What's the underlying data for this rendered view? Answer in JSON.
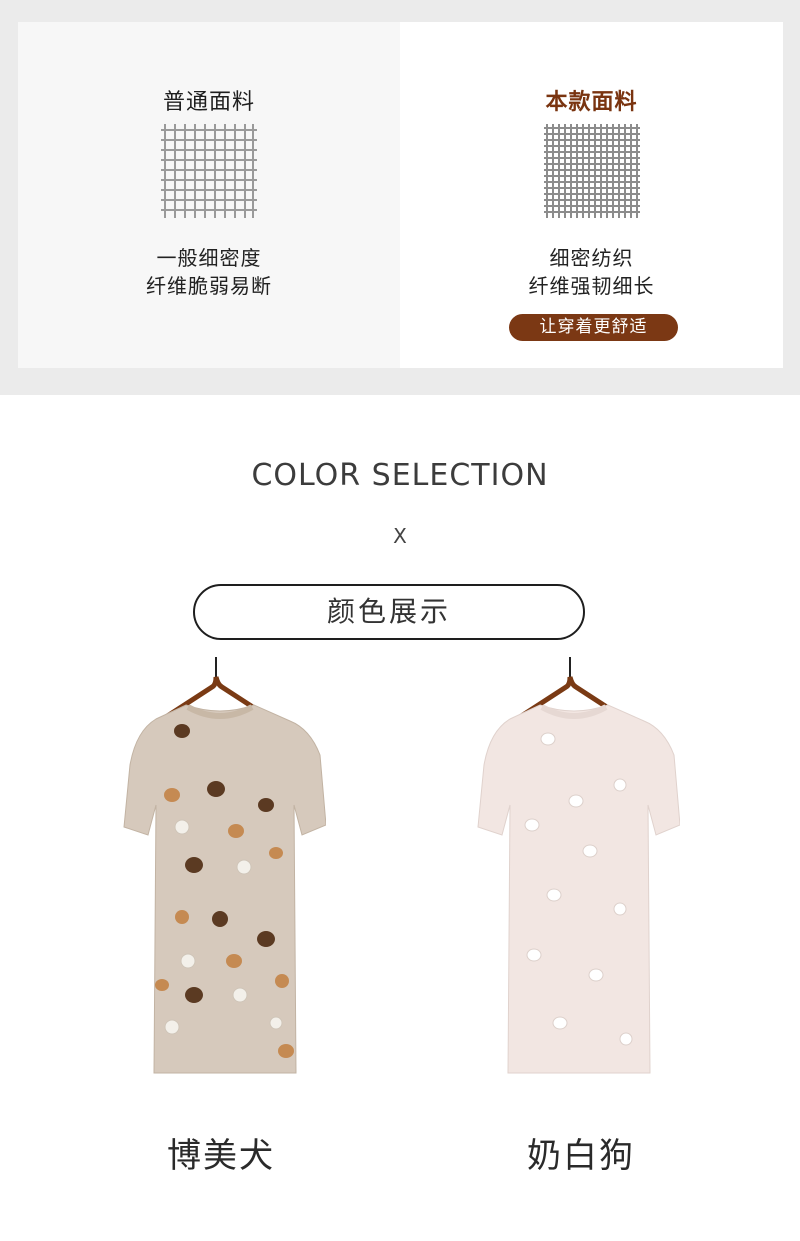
{
  "comparison": {
    "left": {
      "title": "普通面料",
      "desc_line1": "一般细密度",
      "desc_line2": "纤维脆弱易断"
    },
    "right": {
      "title": "本款面料",
      "desc_line1": "细密纺织",
      "desc_line2": "纤维强韧细长",
      "badge": "让穿着更舒适"
    },
    "colors": {
      "accent": "#7b3814",
      "title_accent": "#7a3410"
    }
  },
  "color_section": {
    "title_en": "COLOR SELECTION",
    "separator": "X",
    "title_cn": "颜色展示"
  },
  "products": [
    {
      "name": "博美犬",
      "fabric_color": "#d6c9bc"
    },
    {
      "name": "奶白狗",
      "fabric_color": "#f2e6e2"
    }
  ]
}
